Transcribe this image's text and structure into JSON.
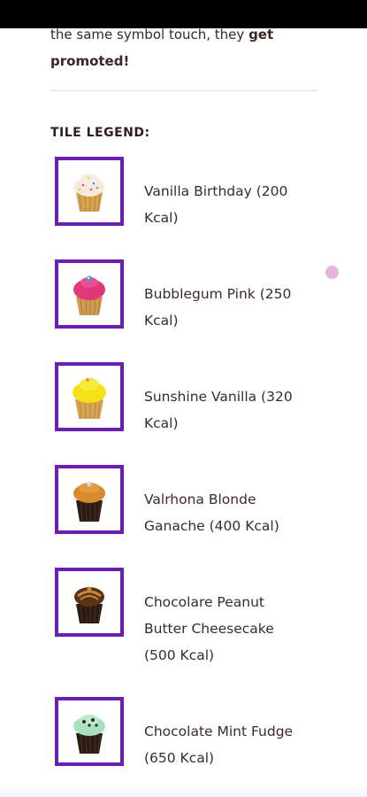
{
  "intro": {
    "line1": "the same symbol touch, they ",
    "line1_bold": "get",
    "line2_bold": "promoted!"
  },
  "legend": {
    "heading": "TILE LEGEND:",
    "items": [
      {
        "label": "Vanilla Birthday (200 Kcal)",
        "icon": "vanilla-birthday-cupcake-icon",
        "frosting": "#f4e9dc",
        "base": "#d9a24f",
        "topping": "#f2c14e"
      },
      {
        "label": "Bubblegum Pink (250 Kcal)",
        "icon": "bubblegum-pink-cupcake-icon",
        "frosting": "#e0387b",
        "base": "#cf9a52",
        "topping": "#6a88d6"
      },
      {
        "label": "Sunshine Vanilla (320 Kcal)",
        "icon": "sunshine-vanilla-cupcake-icon",
        "frosting": "#f5e11a",
        "base": "#d8a454",
        "topping": "#e39c2a"
      },
      {
        "label": "Valrhona Blonde Ganache (400 Kcal)",
        "icon": "valrhona-blonde-ganache-cupcake-icon",
        "frosting": "#d98a2a",
        "base": "#2b1b14",
        "topping": "#c7c7c7"
      },
      {
        "label": "Chocolare Peanut Butter Cheesecake (500 Kcal)",
        "icon": "chocolate-peanut-butter-cheesecake-cupcake-icon",
        "frosting": "#5b3216",
        "base": "#2a1a12",
        "topping": "#c78a3c"
      },
      {
        "label": "Chocolate Mint Fudge (650 Kcal)",
        "icon": "chocolate-mint-fudge-cupcake-icon",
        "frosting": "#a8e0c0",
        "base": "#2b1b14",
        "topping": "#3a2418"
      }
    ]
  },
  "colors": {
    "tile_border": "#6a1fb0",
    "divider": "#e9d6df",
    "indicator_dot": "#e7b3d8"
  }
}
